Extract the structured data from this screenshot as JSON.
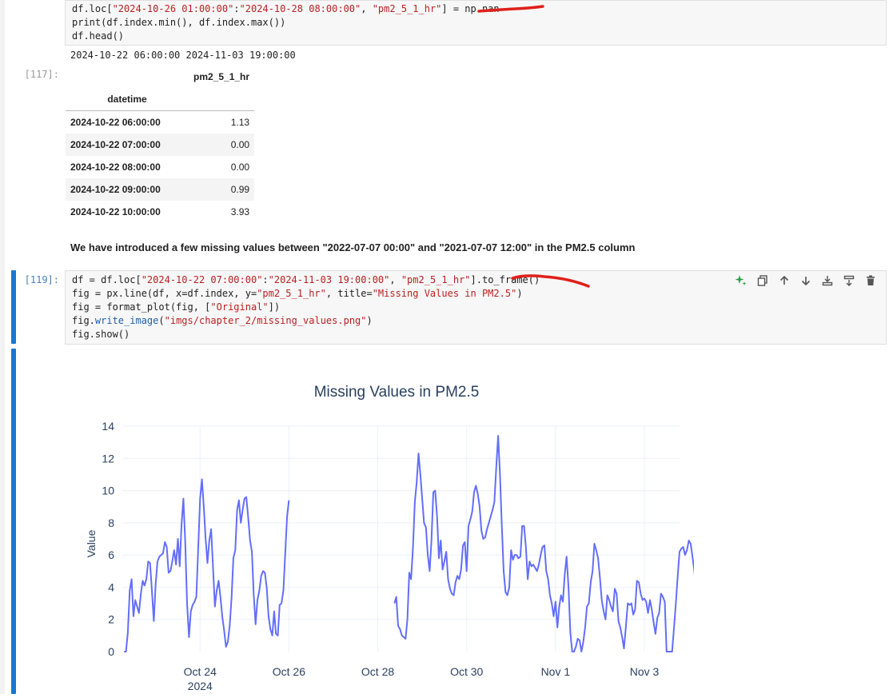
{
  "cells": {
    "cell1": {
      "lines": [
        [
          {
            "t": "df.loc["
          },
          {
            "t": "\"2024-10-26 01:00:00\"",
            "c": "k-str"
          },
          {
            "t": ":"
          },
          {
            "t": "\"2024-10-28 08:00:00\"",
            "c": "k-str"
          },
          {
            "t": ", "
          },
          {
            "t": "\"pm2_5_1_hr\"",
            "c": "k-str"
          },
          {
            "t": "] = np.nan"
          }
        ],
        [
          {
            "t": "print(df.index.min(), df.index.max())"
          }
        ],
        [
          {
            "t": "df.head()"
          }
        ]
      ],
      "stdout": "2024-10-22 06:00:00 2024-11-03 19:00:00",
      "out_prompt": "[117]:",
      "table": {
        "column": "pm2_5_1_hr",
        "index_name": "datetime",
        "rows": [
          {
            "idx": "2024-10-22 06:00:00",
            "val": "1.13"
          },
          {
            "idx": "2024-10-22 07:00:00",
            "val": "0.00"
          },
          {
            "idx": "2024-10-22 08:00:00",
            "val": "0.00"
          },
          {
            "idx": "2024-10-22 09:00:00",
            "val": "0.99"
          },
          {
            "idx": "2024-10-22 10:00:00",
            "val": "3.93"
          }
        ]
      }
    },
    "markdown": "We have introduced a few missing values between \"2022-07-07 00:00\" and \"2021-07-07 12:00\" in the PM2.5 column",
    "cell2": {
      "prompt": "[119]:",
      "lines": [
        [
          {
            "t": "df = df.loc["
          },
          {
            "t": "\"2024-10-22 07:00:00\"",
            "c": "k-str"
          },
          {
            "t": ":"
          },
          {
            "t": "\"2024-11-03 19:00:00\"",
            "c": "k-str"
          },
          {
            "t": ", "
          },
          {
            "t": "\"pm2_5_1_hr\"",
            "c": "k-str"
          },
          {
            "t": "].to_frame()"
          }
        ],
        [
          {
            "t": "fig = px.line(df, x=df.index, y="
          },
          {
            "t": "\"pm2_5_1_hr\"",
            "c": "k-str"
          },
          {
            "t": ", title="
          },
          {
            "t": "\"Missing Values in PM2.5\"",
            "c": "k-str"
          },
          {
            "t": ")"
          }
        ],
        [
          {
            "t": "fig = format_plot(fig, ["
          },
          {
            "t": "\"Original\"",
            "c": "k-str"
          },
          {
            "t": "])"
          }
        ],
        [
          {
            "t": "fig."
          },
          {
            "t": "write_image",
            "c": "k-attr"
          },
          {
            "t": "("
          },
          {
            "t": "\"imgs/chapter_2/missing_values.png\"",
            "c": "k-str"
          },
          {
            "t": ")"
          }
        ],
        [
          {
            "t": "fig.show()"
          }
        ]
      ]
    }
  },
  "toolbar_icons": [
    "sparkle-icon",
    "copy-icon",
    "arrow-up-icon",
    "arrow-down-icon",
    "insert-above-icon",
    "insert-below-icon",
    "trash-icon"
  ],
  "colors": {
    "line": "#636efa",
    "annotation": "#e0201b",
    "active_cell": "#1976d2"
  },
  "chart_data": {
    "type": "line",
    "title": "Missing Values in PM2.5",
    "ylabel": "Value",
    "xlabel": "",
    "ylim": [
      0,
      14
    ],
    "yticks": [
      0,
      2,
      4,
      6,
      8,
      10,
      12,
      14
    ],
    "xticks": [
      {
        "date": "2024-10-24",
        "label": "Oct 24",
        "sub": "2024"
      },
      {
        "date": "2024-10-26",
        "label": "Oct 26"
      },
      {
        "date": "2024-10-28",
        "label": "Oct 28"
      },
      {
        "date": "2024-10-30",
        "label": "Oct 30"
      },
      {
        "date": "2024-11-01",
        "label": "Nov 1"
      },
      {
        "date": "2024-11-03",
        "label": "Nov 3"
      }
    ],
    "series": [
      {
        "start": "2024-10-22 07:00",
        "interval_hours": 1,
        "values": [
          0,
          0,
          1.2,
          3.8,
          4.5,
          2.2,
          3.2,
          2.8,
          2.4,
          3.6,
          4.4,
          4.1,
          4.5,
          5.6,
          5.5,
          3.8,
          1.9,
          4.2,
          5.6,
          5.9,
          6.0,
          6.1,
          6.8,
          6.5,
          4.9,
          5.0,
          5.6,
          6.3,
          5.4,
          7.0,
          5.3,
          7.9,
          9.5,
          6.8,
          3.0,
          0.9,
          2.5,
          2.9,
          3.1,
          3.4,
          6.4,
          9.5,
          10.7,
          9.0,
          7.0,
          5.5,
          6.9,
          7.6,
          5.2,
          2.8,
          3.8,
          4.4,
          3.4,
          2.2,
          1.3,
          0.3,
          0.6,
          1.6,
          3.3,
          5.8,
          6.3,
          8.8,
          9.4,
          8.0,
          8.8,
          9.5,
          9.6,
          8.3,
          6.9,
          6.2,
          3.5,
          1.7,
          3.2,
          3.8,
          4.7,
          5.0,
          4.9,
          4.0,
          2.2,
          1.4,
          1.0,
          2.5,
          1.1,
          1.0,
          2.9,
          3.0,
          3.8,
          6.1,
          8.4,
          9.4,
          null,
          null,
          null,
          null,
          null,
          null,
          null,
          null,
          null,
          null,
          null,
          null,
          null,
          null,
          null,
          null,
          null,
          null,
          null,
          null,
          null,
          null,
          null,
          null,
          null,
          null,
          null,
          null,
          null,
          null,
          null,
          null,
          null,
          null,
          null,
          null,
          null,
          null,
          null,
          null,
          null,
          null,
          null,
          null,
          null,
          null,
          null,
          null,
          null,
          null,
          null,
          null,
          null,
          null,
          null,
          null,
          3.0,
          3.4,
          1.6,
          1.4,
          1.0,
          0.9,
          0.8,
          2.0,
          4.9,
          4.5,
          6.5,
          9.3,
          10.5,
          12.3,
          11.0,
          9.5,
          8.0,
          7.7,
          6.0,
          5.0,
          6.9,
          9.9,
          10.0,
          8.4,
          5.8,
          6.9,
          5.1,
          5.6,
          6.2,
          4.5,
          3.9,
          3.6,
          3.5,
          4.3,
          4.7,
          4.5,
          5.1,
          6.6,
          6.8,
          5.0,
          7.8,
          8.2,
          8.7,
          9.9,
          10.3,
          9.8,
          9.0,
          7.5,
          7.0,
          7.1,
          7.6,
          8.0,
          8.4,
          8.8,
          9.3,
          11.5,
          13.4,
          11.0,
          7.8,
          5.0,
          3.7,
          3.5,
          4.0,
          6.3,
          5.7,
          6.0,
          6.0,
          5.8,
          5.9,
          7.8,
          7.8,
          6.5,
          4.5,
          5.6,
          5.3,
          5.4,
          5.2,
          5.0,
          5.4,
          6.0,
          6.5,
          6.6,
          5.0,
          4.5,
          3.5,
          3.0,
          2.2,
          3.1,
          1.5,
          2.8,
          3.5,
          3.1,
          4.8,
          5.9,
          4.0,
          1.2,
          0.0,
          0.0,
          0.3,
          0.8,
          0.7,
          0.0,
          0.6,
          1.5,
          2.8,
          3.0,
          4.3,
          5.0,
          6.7,
          6.3,
          5.8,
          4.6,
          3.2,
          2.5,
          2.0,
          3.5,
          3.2,
          2.8,
          2.5,
          3.9,
          3.6,
          1.9,
          1.5,
          0.9,
          0.2,
          1.5,
          3.0,
          2.9,
          3.0,
          2.3,
          2.6,
          4.4,
          4.3,
          3.6,
          3.2,
          3.3,
          3.1,
          2.4,
          3.2,
          2.6,
          1.8,
          1.1,
          2.1,
          2.4,
          3.6,
          3.4,
          3.1,
          0.0,
          0.0,
          0.0,
          0.0,
          1.5,
          3.0,
          4.7,
          6.2,
          6.4,
          6.5,
          6.0,
          6.3,
          6.9,
          6.7,
          5.9,
          5.0,
          3.8,
          2.1,
          4.4,
          4.4,
          5.7,
          9.6,
          10.2,
          10.4,
          7.0,
          6.5,
          6.2,
          5.9,
          5.3,
          5.2,
          6.5
        ]
      }
    ]
  }
}
